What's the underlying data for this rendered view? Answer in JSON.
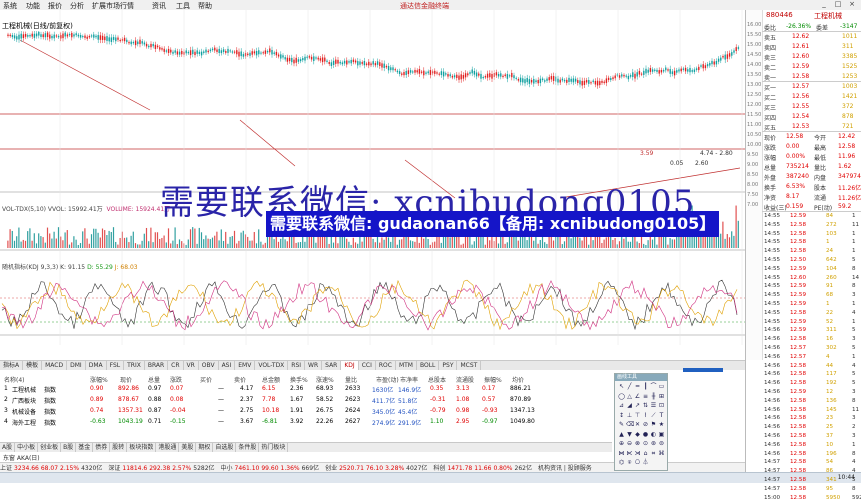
{
  "menu": [
    "系统",
    "功能",
    "报价",
    "分析",
    "扩展市场行情",
    "资讯",
    "工具",
    "帮助"
  ],
  "app_title": "通达信金融终端",
  "window_buttons": [
    "_",
    "□",
    "×"
  ],
  "stock_title": "工程机械(日线/前复权)",
  "volume_label": {
    "prefix": "VOL-TDX(5,10) VVOL: 15992.41万",
    "vol": "VOLUME: 15924.41万"
  },
  "indicator_label": {
    "prefix": "随机指标(KDJ 9,3,3) K: 91.15",
    "d": "D: 55.29",
    "j": "J: 68.03"
  },
  "chart_tabs": [
    "指标A",
    "模板",
    "MACD",
    "DMI",
    "DMA",
    "FSL",
    "TRIX",
    "BRAR",
    "CR",
    "VR",
    "OBV",
    "ASI",
    "EMV",
    "VOL-TDX",
    "RSI",
    "WR",
    "SAR",
    "KDJ",
    "CCI",
    "ROC",
    "MTM",
    "BOLL",
    "PSY",
    "MCST"
  ],
  "selected_tab": "KDJ",
  "price_markers": [
    "3.59",
    "0.05",
    "2.60",
    "4.74 - 2.80"
  ],
  "watermark_text": "需要联系微信: xcnibudong0105",
  "watermark_box": "需要联系微信: gudaonan66【备用: xcnibudong0105】",
  "table": {
    "headers": [
      "名称(4)",
      "涨幅%",
      "现价",
      "总量",
      "涨跌",
      "买价",
      "卖价",
      "总金额",
      "换手%",
      "涨速%",
      "量比",
      "市盈(动)",
      "市净率",
      "总股本",
      "流通股",
      "振幅%",
      "均价"
    ],
    "rows": [
      {
        "idx": "1",
        "name": "工程机械",
        "sub": "指数",
        "chg": "0.90",
        "price": "892.86",
        "vol": "0.97",
        "diff": "0.07",
        "dash": "—",
        "c1": "4.17",
        "c2": "6.15",
        "c3": "2.36",
        "c4": "68.93",
        "c5": "2633",
        "c6": "1630亿",
        "c7": "146.9亿",
        "c8": "0.35",
        "c9": "3.13",
        "c10": "0.17",
        "c11": "886.21",
        "dir": "up"
      },
      {
        "idx": "2",
        "name": "广西板块",
        "sub": "指数",
        "chg": "0.89",
        "price": "878.67",
        "vol": "0.88",
        "diff": "0.08",
        "dash": "—",
        "c1": "2.37",
        "c2": "7.78",
        "c3": "1.67",
        "c4": "58.52",
        "c5": "2623",
        "c6": "411.7亿",
        "c7": "51.8亿",
        "c8": "-0.31",
        "c9": "1.08",
        "c10": "0.57",
        "c11": "870.89",
        "dir": "up"
      },
      {
        "idx": "3",
        "name": "机械设备",
        "sub": "指数",
        "chg": "0.74",
        "price": "1357.31",
        "vol": "0.87",
        "diff": "-0.04",
        "dash": "—",
        "c1": "2.75",
        "c2": "10.18",
        "c3": "1.91",
        "c4": "26.75",
        "c5": "2624",
        "c6": "345.0亿",
        "c7": "45.4亿",
        "c8": "-0.79",
        "c9": "0.98",
        "c10": "-0.93",
        "c11": "1347.13",
        "dir": "up"
      },
      {
        "idx": "4",
        "name": "海外工程",
        "sub": "指数",
        "chg": "-0.63",
        "price": "1043.19",
        "vol": "0.71",
        "diff": "-0.15",
        "dash": "—",
        "c1": "3.67",
        "c2": "-6.81",
        "c3": "3.92",
        "c4": "22.26",
        "c5": "2627",
        "c6": "274.9亿",
        "c7": "291.9亿",
        "c8": "1.10",
        "c9": "2.95",
        "c10": "-0.97",
        "c11": "1049.80",
        "dir": "dn"
      }
    ]
  },
  "bottom_tabs": [
    "A股",
    "中小板",
    "创业板",
    "B股",
    "基金",
    "债券",
    "股转",
    "板块指数",
    "港股通",
    "美股",
    "期权",
    "自选股",
    "条件股",
    "热门板块"
  ],
  "status_line": "东窗 AKA(日)",
  "status_bar": [
    {
      "label": "上证",
      "value": "3234.66",
      "chg": "68.07",
      "pct": "2.15%",
      "amt": "4320亿"
    },
    {
      "label": "深证",
      "value": "11814.6",
      "chg": "292.38",
      "pct": "2.57%",
      "amt": "5282亿"
    },
    {
      "label": "中小",
      "value": "7461.10",
      "chg": "99.60",
      "pct": "1.36%",
      "amt": "669亿"
    },
    {
      "label": "创业",
      "value": "2520.71",
      "chg": "76.10",
      "pct": "3.28%",
      "amt": "4027亿"
    },
    {
      "label": "科创",
      "value": "1471.78",
      "chg": "11.66",
      "pct": "0.80%",
      "amt": "262亿"
    }
  ],
  "status_extra": "机构资讯 | 投顾服务",
  "clock": "10:44",
  "tool_title": "画线工具",
  "tool_icons": [
    "↖",
    "╱",
    "━",
    "┃",
    "⌒",
    "▭",
    "◯",
    "△",
    "∠",
    "≡",
    "╫",
    "⊞",
    "⊿",
    "◢",
    "↗",
    "⇅",
    "☰",
    "⊡",
    "↕",
    "⊥",
    "⊤",
    "⌇",
    "⟋",
    "T",
    "✎",
    "⌫",
    "✕",
    "⊘",
    "⚑",
    "★",
    "▲",
    "▼",
    "◆",
    "●",
    "◐",
    "▣",
    "⊕",
    "⊖",
    "⊗",
    "⊙",
    "⊛",
    "⊜",
    "⋈",
    "⋉",
    "⋊",
    "⌂",
    "⌗",
    "⌘",
    "⌬",
    "⍟",
    "⎔",
    "⏃"
  ],
  "right_panel": {
    "title": "工程机械",
    "code": "880446",
    "scale": [
      "16.00",
      "15.50",
      "15.00",
      "14.50",
      "14.00",
      "13.50",
      "13.00",
      "12.50",
      "12.00",
      "11.50",
      "11.00",
      "10.50",
      "10.00",
      "9.50",
      "9.00",
      "8.50",
      "8.00",
      "7.50",
      "7.00"
    ],
    "quote_head": [
      {
        "a": "委比",
        "b": "-26.36%",
        "c": "委差",
        "d": "-3147"
      }
    ],
    "asks": [
      {
        "l": "卖五",
        "p": "12.62",
        "v": "1011"
      },
      {
        "l": "卖四",
        "p": "12.61",
        "v": "311"
      },
      {
        "l": "卖三",
        "p": "12.60",
        "v": "3385"
      },
      {
        "l": "卖二",
        "p": "12.59",
        "v": "1525"
      },
      {
        "l": "卖一",
        "p": "12.58",
        "v": "1253"
      }
    ],
    "bids": [
      {
        "l": "买一",
        "p": "12.57",
        "v": "1003"
      },
      {
        "l": "买二",
        "p": "12.56",
        "v": "1421"
      },
      {
        "l": "买三",
        "p": "12.55",
        "v": "372"
      },
      {
        "l": "买四",
        "p": "12.54",
        "v": "878"
      },
      {
        "l": "买五",
        "p": "12.53",
        "v": "721"
      }
    ],
    "stats": [
      {
        "a": "现价",
        "b": "12.58",
        "c": "今开",
        "d": "12.42"
      },
      {
        "a": "涨跌",
        "b": "0.00",
        "c": "最高",
        "d": "12.58"
      },
      {
        "a": "涨幅",
        "b": "0.00%",
        "c": "最低",
        "d": "11.96"
      },
      {
        "a": "总量",
        "b": "735214",
        "c": "量比",
        "d": "1.62"
      },
      {
        "a": "外盘",
        "b": "387240",
        "c": "内盘",
        "d": "347974"
      },
      {
        "a": "换手",
        "b": "6.53%",
        "c": "股本",
        "d": "11.26亿"
      },
      {
        "a": "净资",
        "b": "8.17",
        "c": "流通",
        "d": "11.26亿"
      },
      {
        "a": "收益(三)",
        "b": "0.159",
        "c": "PE(动)",
        "d": "59.2"
      }
    ],
    "ticks": [
      {
        "t": "14:55",
        "p": "12.59",
        "v": "84",
        "n": "1"
      },
      {
        "t": "14:55",
        "p": "12.58",
        "v": "272",
        "n": "11"
      },
      {
        "t": "14:55",
        "p": "12.58",
        "v": "103",
        "n": "1"
      },
      {
        "t": "14:55",
        "p": "12.58",
        "v": "1",
        "n": "1"
      },
      {
        "t": "14:55",
        "p": "12.58",
        "v": "24",
        "n": "1"
      },
      {
        "t": "14:55",
        "p": "12.50",
        "v": "642",
        "n": "5"
      },
      {
        "t": "14:55",
        "p": "12.59",
        "v": "104",
        "n": "8"
      },
      {
        "t": "14:55",
        "p": "12.60",
        "v": "260",
        "n": "14"
      },
      {
        "t": "14:55",
        "p": "12.59",
        "v": "91",
        "n": "8"
      },
      {
        "t": "14:55",
        "p": "12.59",
        "v": "68",
        "n": "3"
      },
      {
        "t": "14:55",
        "p": "12.59",
        "v": "1",
        "n": "1"
      },
      {
        "t": "14:55",
        "p": "12.58",
        "v": "22",
        "n": "4"
      },
      {
        "t": "14:55",
        "p": "12.59",
        "v": "52",
        "n": "1"
      },
      {
        "t": "14:56",
        "p": "12.59",
        "v": "311",
        "n": "5"
      },
      {
        "t": "14:56",
        "p": "12.58",
        "v": "16",
        "n": "3"
      },
      {
        "t": "14:56",
        "p": "12.57",
        "v": "302",
        "n": "5"
      },
      {
        "t": "14:56",
        "p": "12.57",
        "v": "4",
        "n": "1"
      },
      {
        "t": "14:56",
        "p": "12.58",
        "v": "44",
        "n": "4"
      },
      {
        "t": "14:56",
        "p": "12.58",
        "v": "117",
        "n": "5"
      },
      {
        "t": "14:56",
        "p": "12.58",
        "v": "192",
        "n": "5"
      },
      {
        "t": "14:56",
        "p": "12.59",
        "v": "12",
        "n": "3"
      },
      {
        "t": "14:56",
        "p": "12.58",
        "v": "136",
        "n": "8"
      },
      {
        "t": "14:56",
        "p": "12.58",
        "v": "145",
        "n": "11"
      },
      {
        "t": "14:56",
        "p": "12.58",
        "v": "23",
        "n": "3"
      },
      {
        "t": "14:56",
        "p": "12.58",
        "v": "25",
        "n": "2"
      },
      {
        "t": "14:56",
        "p": "12.58",
        "v": "37",
        "n": "3"
      },
      {
        "t": "14:56",
        "p": "12.58",
        "v": "10",
        "n": "1"
      },
      {
        "t": "14:56",
        "p": "12.58",
        "v": "196",
        "n": "8"
      },
      {
        "t": "14:57",
        "p": "12.58",
        "v": "54",
        "n": "4"
      },
      {
        "t": "14:57",
        "p": "12.58",
        "v": "86",
        "n": "4"
      },
      {
        "t": "14:57",
        "p": "12.58",
        "v": "341",
        "n": "5"
      },
      {
        "t": "14:57",
        "p": "12.58",
        "v": "95",
        "n": "8"
      },
      {
        "t": "15:00",
        "p": "12.58",
        "v": "5950",
        "n": "592"
      }
    ]
  }
}
